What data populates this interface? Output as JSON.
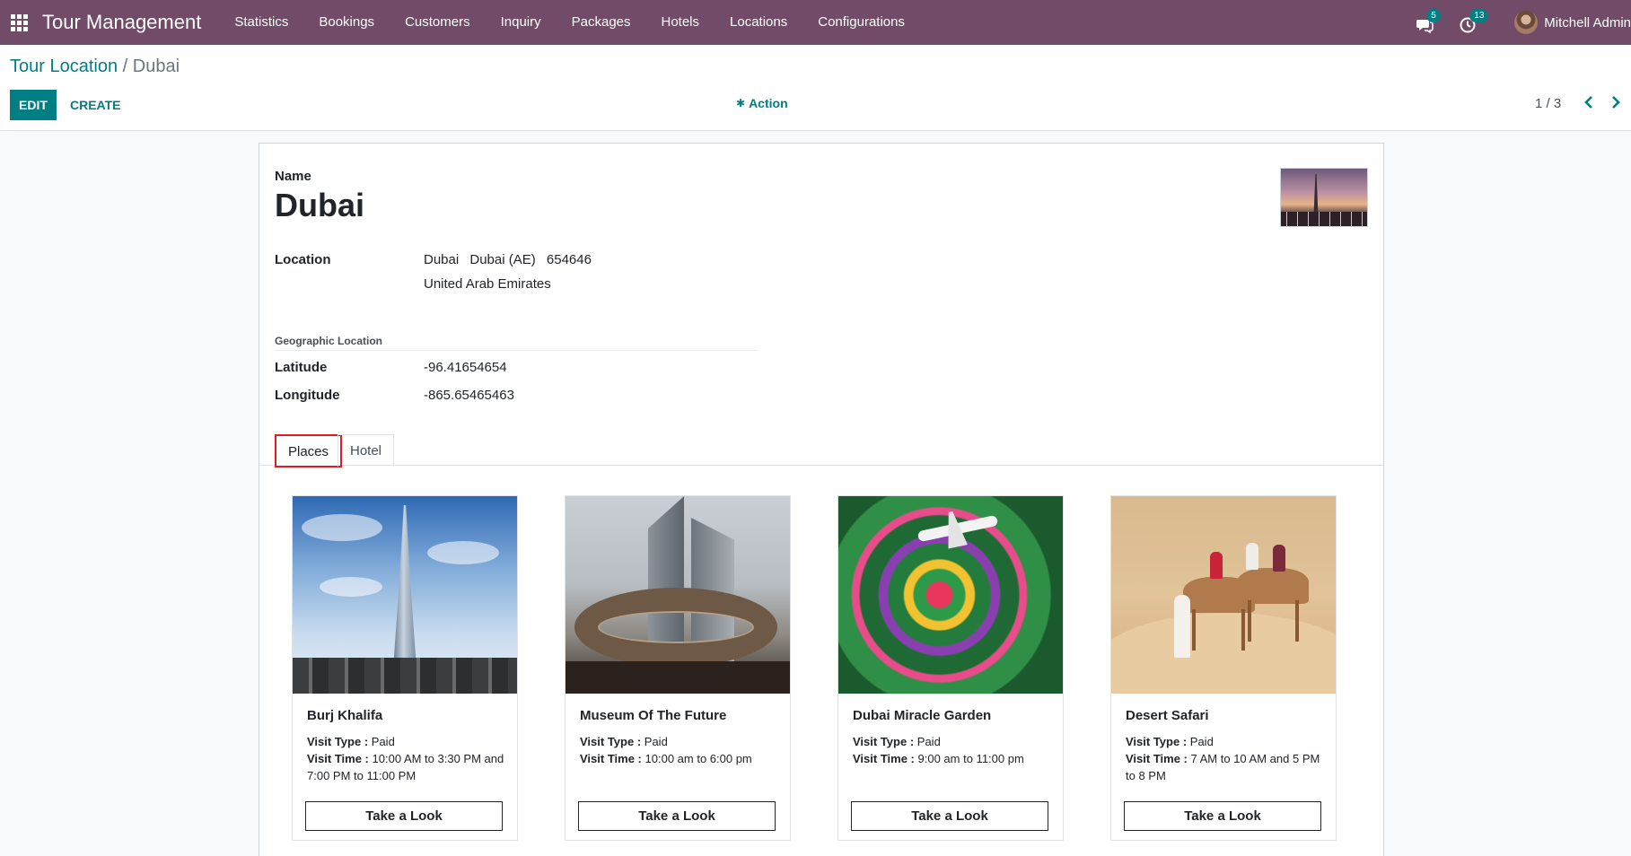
{
  "navbar": {
    "app_name": "Tour Management",
    "menu": [
      "Statistics",
      "Bookings",
      "Customers",
      "Inquiry",
      "Packages",
      "Hotels",
      "Locations",
      "Configurations"
    ],
    "messages_count": "5",
    "activities_count": "13",
    "user_name": "Mitchell Admin"
  },
  "control_panel": {
    "breadcrumb_parent": "Tour Location",
    "breadcrumb_separator": "/",
    "breadcrumb_current": "Dubai",
    "edit_label": "EDIT",
    "create_label": "CREATE",
    "action_label": "Action",
    "pager": "1 / 3"
  },
  "record": {
    "name_label": "Name",
    "name": "Dubai",
    "location_label": "Location",
    "location_line1": [
      "Dubai",
      "Dubai (AE)",
      "654646"
    ],
    "location_line2": "United Arab Emirates",
    "geo_title": "Geographic Location",
    "latitude_label": "Latitude",
    "latitude": "-96.41654654",
    "longitude_label": "Longitude",
    "longitude": "-865.65465463"
  },
  "tabs": [
    "Places",
    "Hotel"
  ],
  "places": [
    {
      "title": "Burj Khalifa",
      "visit_type_label": "Visit Type :",
      "visit_type": "Paid",
      "visit_time_label": "Visit Time :",
      "visit_time": "10:00 AM to 3:30 PM and 7:00 PM to 11:00 PM",
      "button": "Take a Look"
    },
    {
      "title": "Museum Of The Future",
      "visit_type_label": "Visit Type :",
      "visit_type": "Paid",
      "visit_time_label": "Visit Time :",
      "visit_time": "10:00 am to 6:00 pm",
      "button": "Take a Look"
    },
    {
      "title": "Dubai Miracle Garden",
      "visit_type_label": "Visit Type :",
      "visit_type": "Paid",
      "visit_time_label": "Visit Time :",
      "visit_time": "9:00 am to 11:00 pm",
      "button": "Take a Look"
    },
    {
      "title": "Desert Safari",
      "visit_type_label": "Visit Type :",
      "visit_type": "Paid",
      "visit_time_label": "Visit Time :",
      "visit_time": "7 AM to 10 AM and 5 PM to 8 PM",
      "button": "Take a Look"
    }
  ],
  "colors": {
    "navbar": "#714b67",
    "primary": "#017e84",
    "highlight": "#e01b24"
  }
}
